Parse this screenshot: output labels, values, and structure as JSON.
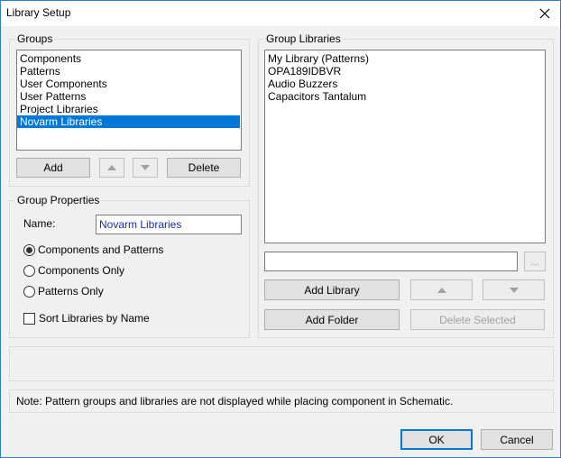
{
  "window": {
    "title": "Library Setup"
  },
  "groups": {
    "legend": "Groups",
    "items": [
      {
        "label": "Components"
      },
      {
        "label": "Patterns"
      },
      {
        "label": "User Components"
      },
      {
        "label": "User Patterns"
      },
      {
        "label": "Project Libraries"
      },
      {
        "label": "Novarm Libraries",
        "selected": true
      }
    ],
    "add_label": "Add",
    "delete_label": "Delete"
  },
  "group_properties": {
    "legend": "Group Properties",
    "name_label": "Name:",
    "name_value": "Novarm Libraries",
    "radio_components_and_patterns": "Components and Patterns",
    "radio_components_only": "Components Only",
    "radio_patterns_only": "Patterns Only",
    "selected_radio": "Components and Patterns",
    "sort_label": "Sort Libraries by Name",
    "sort_checked": false
  },
  "group_libraries": {
    "legend": "Group Libraries",
    "items": [
      {
        "label": "My Library (Patterns)"
      },
      {
        "label": "OPA189IDBVR"
      },
      {
        "label": "Audio Buzzers"
      },
      {
        "label": "Capacitors Tantalum"
      }
    ],
    "path_value": "",
    "browse_label": "...",
    "add_library_label": "Add Library",
    "add_folder_label": "Add Folder",
    "delete_selected_label": "Delete Selected"
  },
  "note": "Note: Pattern groups and libraries are not displayed while placing component in Schematic.",
  "buttons": {
    "ok": "OK",
    "cancel": "Cancel"
  },
  "colors": {
    "selection": "#0078d7",
    "name_text": "#1a2fa8",
    "accent_border": "#0078d7"
  }
}
